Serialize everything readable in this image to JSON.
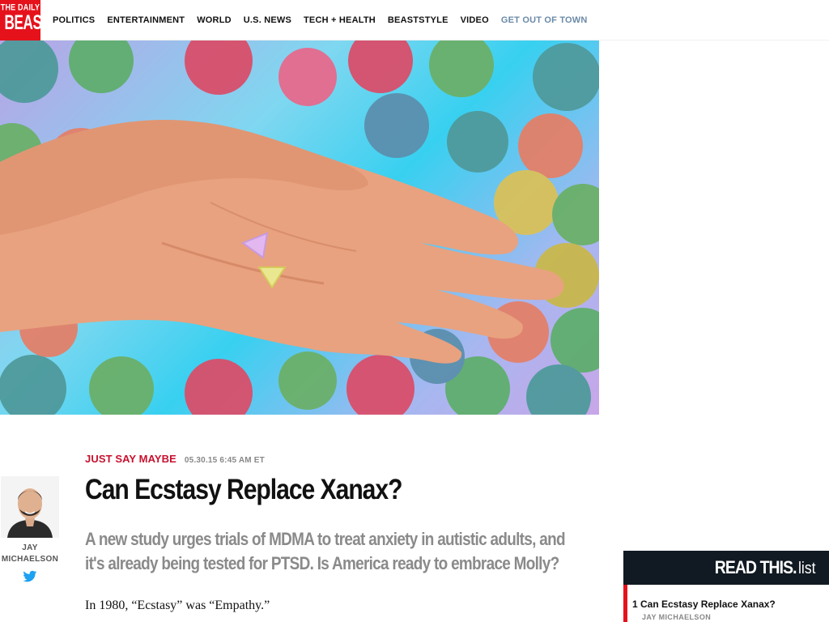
{
  "site": {
    "logo_line1": "THE DAILY",
    "logo_line2": "BEAST",
    "brand_color": "#e5121b"
  },
  "nav": {
    "items": [
      {
        "label": "POLITICS"
      },
      {
        "label": "ENTERTAINMENT"
      },
      {
        "label": "WORLD"
      },
      {
        "label": "U.S. NEWS"
      },
      {
        "label": "TECH + HEALTH"
      },
      {
        "label": "BEASTSTYLE"
      },
      {
        "label": "VIDEO"
      },
      {
        "label": "GET OUT OF TOWN"
      }
    ],
    "accent_color": "#6b8aa8"
  },
  "hero": {
    "camera_icon": "camera-icon"
  },
  "article": {
    "category": "JUST SAY MAYBE",
    "date": "05.30.15 6:45 AM ET",
    "headline": "Can Ecstasy Replace Xanax?",
    "dek": "A new study urges trials of MDMA to treat anxiety in autistic adults, and it's already being tested for PTSD. Is America ready to embrace Molly?",
    "first_paragraph": "In 1980, “Ecstasy” was “Empathy.”",
    "author": {
      "name": "JAY MICHAELSON",
      "social_icon": "twitter-icon"
    }
  },
  "read_this": {
    "title_bold": "READ THIS.",
    "title_light": "list",
    "items": [
      {
        "number": "1",
        "title": "Can Ecstasy Replace Xanax?",
        "byline": "JAY MICHAELSON"
      }
    ]
  }
}
